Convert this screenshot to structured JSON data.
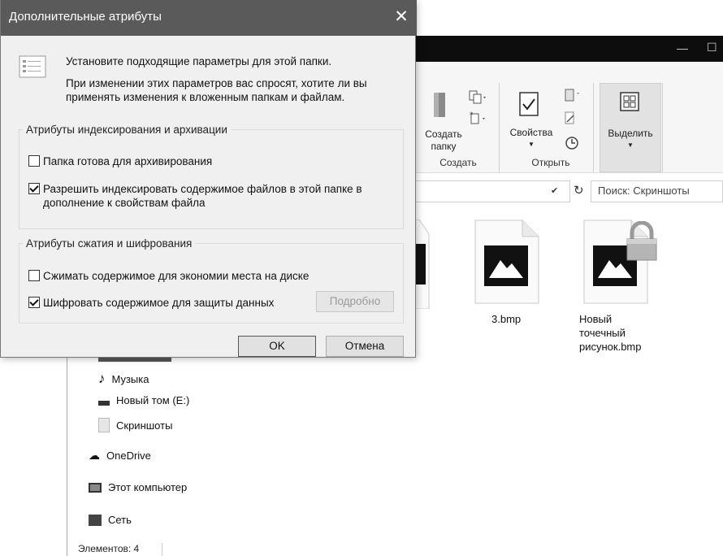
{
  "dialog": {
    "title": "Дополнительные атрибуты",
    "intro_line1": "Установите подходящие параметры для этой папки.",
    "intro_line2": "При изменении этих параметров вас спросят, хотите ли вы",
    "intro_line3": "применять изменения к вложенным папкам и файлам.",
    "index_group": {
      "legend": "Атрибуты индексирования и архивации",
      "archive_label": "Папка готова для архивирования",
      "archive_checked": false,
      "index_label_line1": "Разрешить индексировать содержимое файлов в этой папке в",
      "index_label_line2": "дополнение к свойствам файла",
      "index_checked": true
    },
    "compress_group": {
      "legend": "Атрибуты сжатия и шифрования",
      "compress_label": "Сжимать содержимое для экономии места на диске",
      "compress_checked": false,
      "encrypt_label": "Шифровать содержимое для защиты данных",
      "encrypt_checked": true,
      "details_button": "Подробно"
    },
    "ok_button": "OK",
    "cancel_button": "Отмена"
  },
  "explorer": {
    "ribbon": {
      "new_folder_label_1": "Создать",
      "new_folder_label_2": "папку",
      "group_create": "Создать",
      "properties_label": "Свойства",
      "group_open": "Открыть",
      "select_label": "Выделить"
    },
    "search_placeholder": "Поиск: Скриншоты",
    "files": [
      {
        "name": "3.bmp"
      },
      {
        "name_line1": "Новый",
        "name_line2": "точечный",
        "name_line3": "рисунок.bmp"
      }
    ],
    "nav": {
      "music": "Музыка",
      "new_volume": "Новый том (E:)",
      "screenshots": "Скриншоты",
      "onedrive": "OneDrive",
      "this_pc": "Этот компьютер",
      "network": "Сеть"
    },
    "status_text": "Элементов: 4"
  }
}
